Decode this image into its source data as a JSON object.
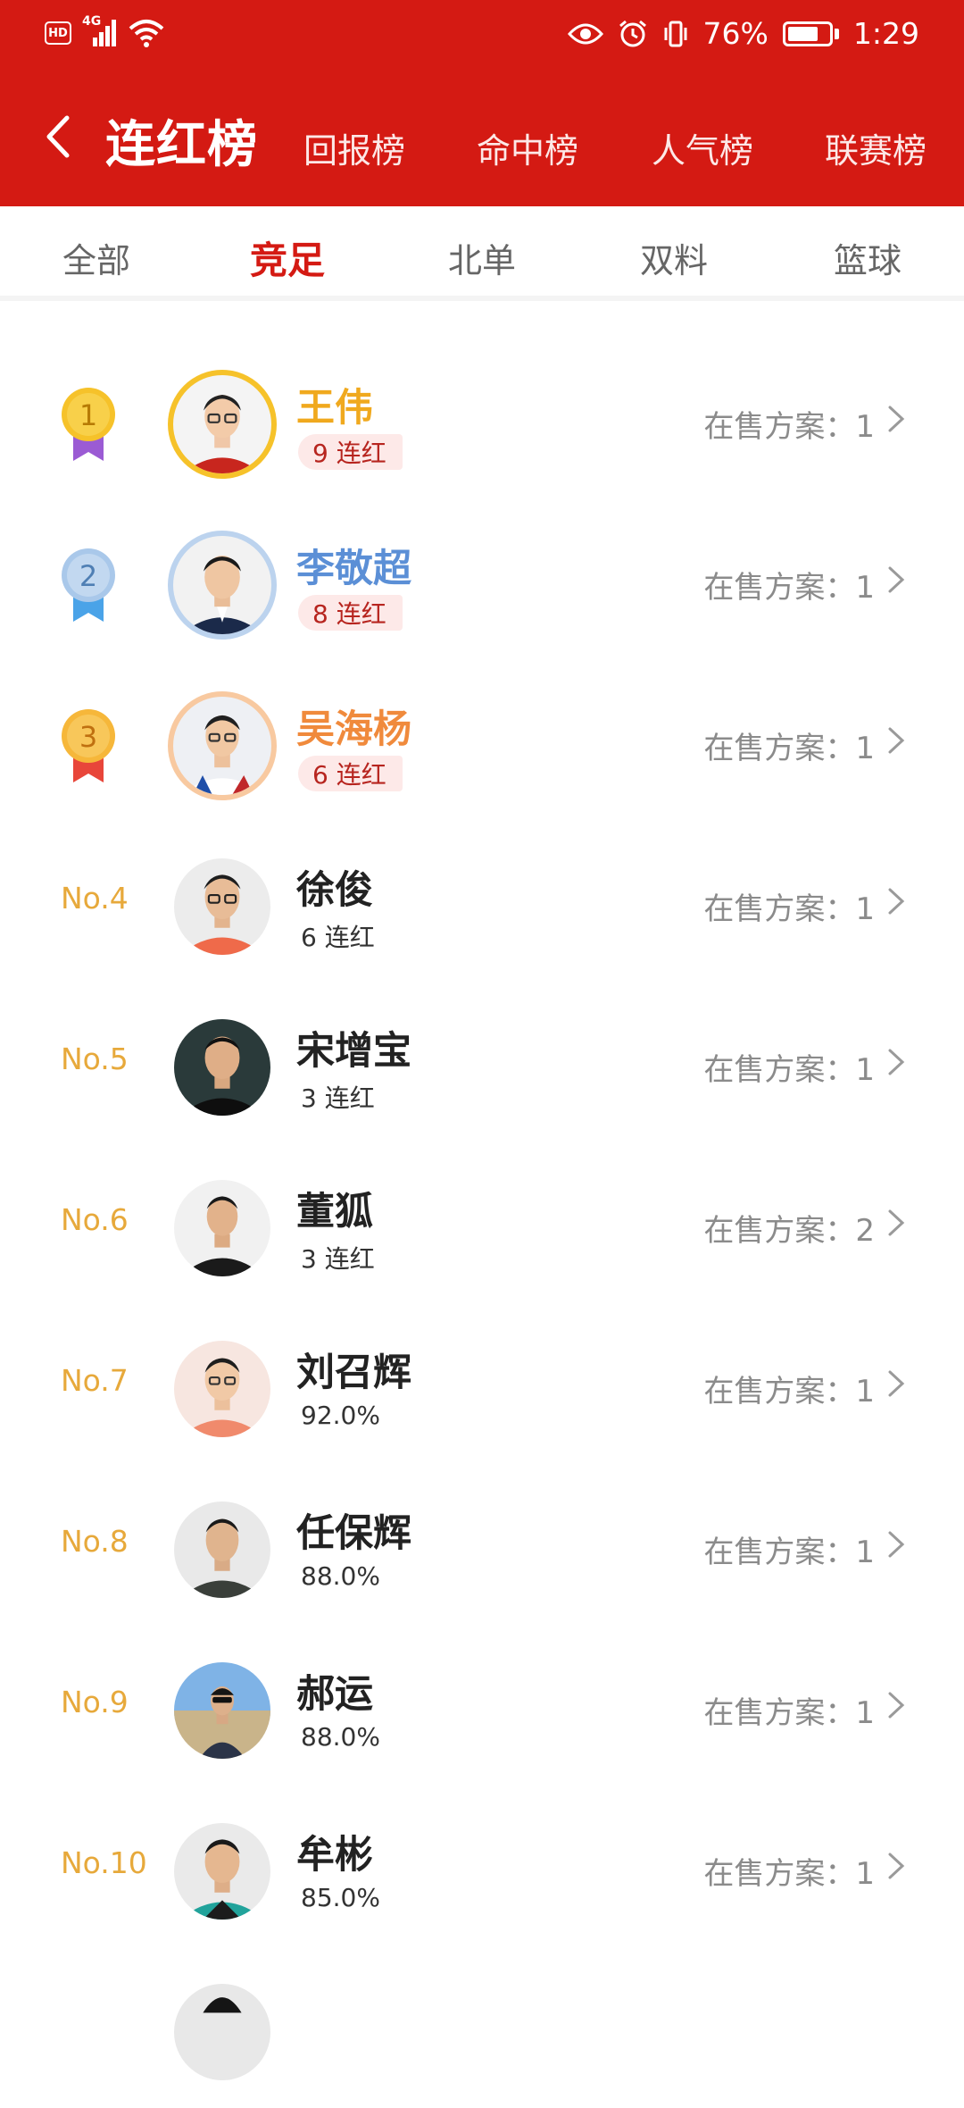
{
  "status_bar": {
    "hd_label": "HD",
    "network_label": "4G",
    "battery_text": "76%",
    "battery_level": 0.76,
    "time": "1:29"
  },
  "header": {
    "title": "连红榜",
    "tabs": [
      {
        "label": "回报榜"
      },
      {
        "label": "命中榜"
      },
      {
        "label": "人气榜"
      },
      {
        "label": "联赛榜"
      }
    ]
  },
  "sub_tabs": {
    "items": [
      {
        "label": "全部"
      },
      {
        "label": "竞足"
      },
      {
        "label": "北单"
      },
      {
        "label": "双料"
      },
      {
        "label": "篮球"
      }
    ],
    "active": "竞足"
  },
  "colors": {
    "brand_red": "#d41a13",
    "gold": "#f0a91e",
    "silver_blue": "#5b8fd6",
    "bronze": "#f08a3c",
    "rank_text": "#e7a93b"
  },
  "list": [
    {
      "rank": "1",
      "name": "王伟",
      "stat": "9 连红",
      "onsale": "在售方案：1",
      "medal": "gold",
      "name_color": "#f0a91e"
    },
    {
      "rank": "2",
      "name": "李敬超",
      "stat": "8 连红",
      "onsale": "在售方案：1",
      "medal": "silver",
      "name_color": "#5b8fd6"
    },
    {
      "rank": "3",
      "name": "吴海杨",
      "stat": "6 连红",
      "onsale": "在售方案：1",
      "medal": "bronze",
      "name_color": "#f08a3c"
    },
    {
      "rank": "No.4",
      "name": "徐俊",
      "stat": "6 连红",
      "onsale": "在售方案：1"
    },
    {
      "rank": "No.5",
      "name": "宋增宝",
      "stat": "3 连红",
      "onsale": "在售方案：1"
    },
    {
      "rank": "No.6",
      "name": "董狐",
      "stat": "3 连红",
      "onsale": "在售方案：2"
    },
    {
      "rank": "No.7",
      "name": "刘召辉",
      "stat": "92.0%",
      "onsale": "在售方案：1"
    },
    {
      "rank": "No.8",
      "name": "任保辉",
      "stat": "88.0%",
      "onsale": "在售方案：1"
    },
    {
      "rank": "No.9",
      "name": "郝运",
      "stat": "88.0%",
      "onsale": "在售方案：1"
    },
    {
      "rank": "No.10",
      "name": "牟彬",
      "stat": "85.0%",
      "onsale": "在售方案：1"
    }
  ]
}
